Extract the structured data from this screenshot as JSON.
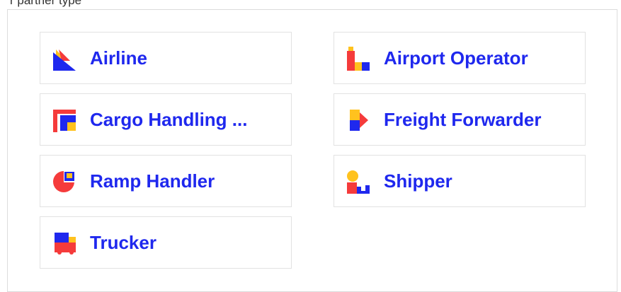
{
  "header": {
    "label": "r partner type"
  },
  "tiles": [
    {
      "label": "Airline",
      "icon": "airline-icon"
    },
    {
      "label": "Airport Operator",
      "icon": "airport-operator-icon"
    },
    {
      "label": "Cargo Handling ...",
      "icon": "cargo-handling-icon"
    },
    {
      "label": "Freight Forwarder",
      "icon": "freight-forwarder-icon"
    },
    {
      "label": "Ramp Handler",
      "icon": "ramp-handler-icon"
    },
    {
      "label": "Shipper",
      "icon": "shipper-icon"
    },
    {
      "label": "Trucker",
      "icon": "trucker-icon"
    }
  ],
  "colors": {
    "label": "#1f28ee",
    "blue": "#1f28ee",
    "red": "#f53b3b",
    "yellow": "#ffc21e",
    "border": "#e2e2e2"
  }
}
